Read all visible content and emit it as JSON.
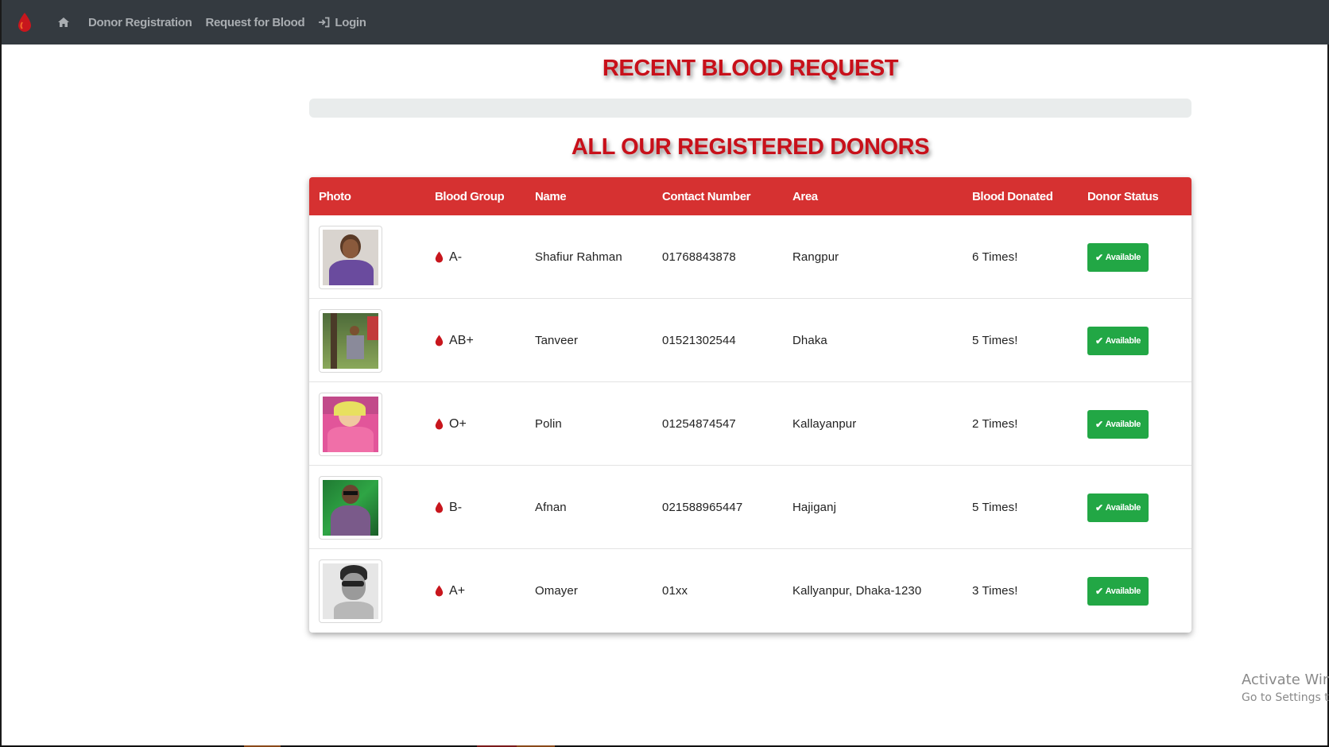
{
  "navbar": {
    "brand_icon": "blood-drop-icon",
    "items": [
      {
        "icon": "home-icon",
        "label": ""
      },
      {
        "icon": "",
        "label": "Donor Registration"
      },
      {
        "icon": "",
        "label": "Request for Blood"
      },
      {
        "icon": "sign-in-icon",
        "label": "Login"
      }
    ]
  },
  "recent_request": {
    "title": "RECENT BLOOD REQUEST"
  },
  "donors": {
    "title": "ALL OUR REGISTERED DONORS",
    "columns": [
      "Photo",
      "Blood Group",
      "Name",
      "Contact Number",
      "Area",
      "Blood Donated",
      "Donor Status"
    ],
    "rows": [
      {
        "photo": "donor-photo",
        "blood_group": "A-",
        "name": "Shafiur Rahman",
        "contact": "01768843878",
        "area": "Rangpur",
        "donated": "6 Times!",
        "status": "Available"
      },
      {
        "photo": "donor-photo",
        "blood_group": "AB+",
        "name": "Tanveer",
        "contact": "01521302544",
        "area": "Dhaka",
        "donated": "5 Times!",
        "status": "Available"
      },
      {
        "photo": "donor-photo",
        "blood_group": "O+",
        "name": "Polin",
        "contact": "01254874547",
        "area": "Kallayanpur",
        "donated": "2 Times!",
        "status": "Available"
      },
      {
        "photo": "donor-photo",
        "blood_group": "B-",
        "name": "Afnan",
        "contact": "021588965447",
        "area": "Hajiganj",
        "donated": "5 Times!",
        "status": "Available"
      },
      {
        "photo": "donor-photo",
        "blood_group": "A+",
        "name": "Omayer",
        "contact": "01xx",
        "area": "Kallyanpur, Dhaka-1230",
        "donated": "3 Times!",
        "status": "Available"
      }
    ]
  },
  "watermark": {
    "line1": "Activate Win",
    "line2": "Go to Settings to"
  },
  "colors": {
    "navbar": "#343a40",
    "accent_red": "#d63131",
    "heading_red": "#c8101a",
    "status_green": "#22a745"
  }
}
